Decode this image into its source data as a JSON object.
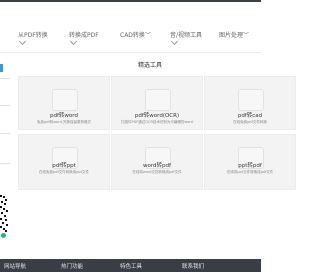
{
  "nav": {
    "items": [
      {
        "label": "从PDF转换"
      },
      {
        "label": "转换成PDF"
      },
      {
        "label": "CAD转换"
      },
      {
        "label": "音/视频工具"
      },
      {
        "label": "图片处理"
      }
    ]
  },
  "main": {
    "section_title": "精选工具",
    "cards": [
      {
        "title": "pdf转word",
        "desc": "免费pdf转word,完美保留原有格式"
      },
      {
        "title": "pdf转word(OCR)",
        "desc": "扫描件PDF通过OCR技术识别为可编辑的word"
      },
      {
        "title": "pdf转cad",
        "desc": "在线免费pdf文件转换"
      },
      {
        "title": "pdf转ppt",
        "desc": "在线免费pdf文件转换成ppt文件"
      },
      {
        "title": "word转pdf",
        "desc": "在线将word文档转换成pdf文件"
      },
      {
        "title": "ppt转pdf",
        "desc": "在线将ppt文件转换成pdf文件"
      }
    ]
  },
  "footer": {
    "items": [
      {
        "label": "网站导航"
      },
      {
        "label": "热门功能"
      },
      {
        "label": "特色工具"
      },
      {
        "label": "联系我们"
      }
    ]
  },
  "colors": {
    "accent": "#2f9ae8",
    "footer_bg": "#3a3d44",
    "card_bg": "#f3f3f3",
    "qr_badge": "#2db46d"
  }
}
